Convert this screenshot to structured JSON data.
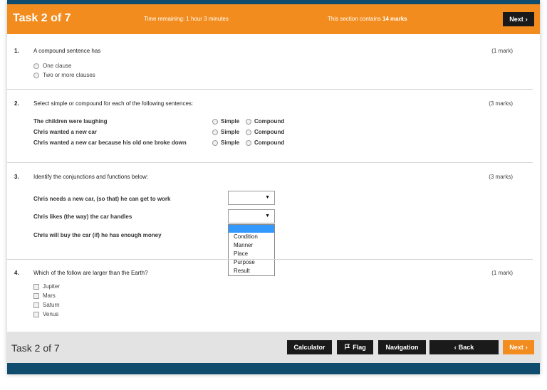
{
  "header": {
    "task": "Task 2 of 7",
    "time_remaining": "Time remaining: 1 hour 3 minutes",
    "section_prefix": "This section contains",
    "section_marks": "14 marks",
    "next_label": "Next",
    "next_icon": "›"
  },
  "q1": {
    "number": "1.",
    "prompt": "A compound sentence has",
    "marks": "(1 mark)",
    "options": [
      "One clause",
      "Two or more clauses"
    ]
  },
  "q2": {
    "number": "2.",
    "prompt": "Select simple or compound for each of the following sentences:",
    "marks": "(3 marks)",
    "rows": [
      {
        "sentence": "The children were laughing",
        "simple": "Simple",
        "compound": "Compound"
      },
      {
        "sentence": "Chris wanted a new car",
        "simple": "Simple",
        "compound": "Compound"
      },
      {
        "sentence": "Chris wanted a new car because his old one broke down",
        "simple": "Simple",
        "compound": "Compound"
      }
    ]
  },
  "q3": {
    "number": "3.",
    "prompt": "Identify the conjunctions and functions below:",
    "marks": "(3 marks)",
    "rows": [
      "Chris needs a new car, (so that) he can get to work",
      "Chris likes (the way) the car handles",
      "Chris will buy the car (if) he has enough money"
    ],
    "dropdown_options": [
      "Condition",
      "Manner",
      "Place",
      "Purpose",
      "Result"
    ]
  },
  "q4": {
    "number": "4.",
    "prompt": "Which of the follow are larger than the Earth?",
    "marks": "(1 mark)",
    "options": [
      "Jupiter",
      "Mars",
      "Saturn",
      "Venus"
    ]
  },
  "footer": {
    "task": "Task 2 of 7",
    "calculator": "Calculator",
    "flag": "Flag",
    "navigation": "Navigation",
    "back": "Back",
    "back_icon": "‹",
    "next": "Next",
    "next_icon": "›"
  },
  "colors": {
    "accent": "#f28c1e",
    "navy": "#0f4c6e",
    "button": "#1a1a1a"
  }
}
